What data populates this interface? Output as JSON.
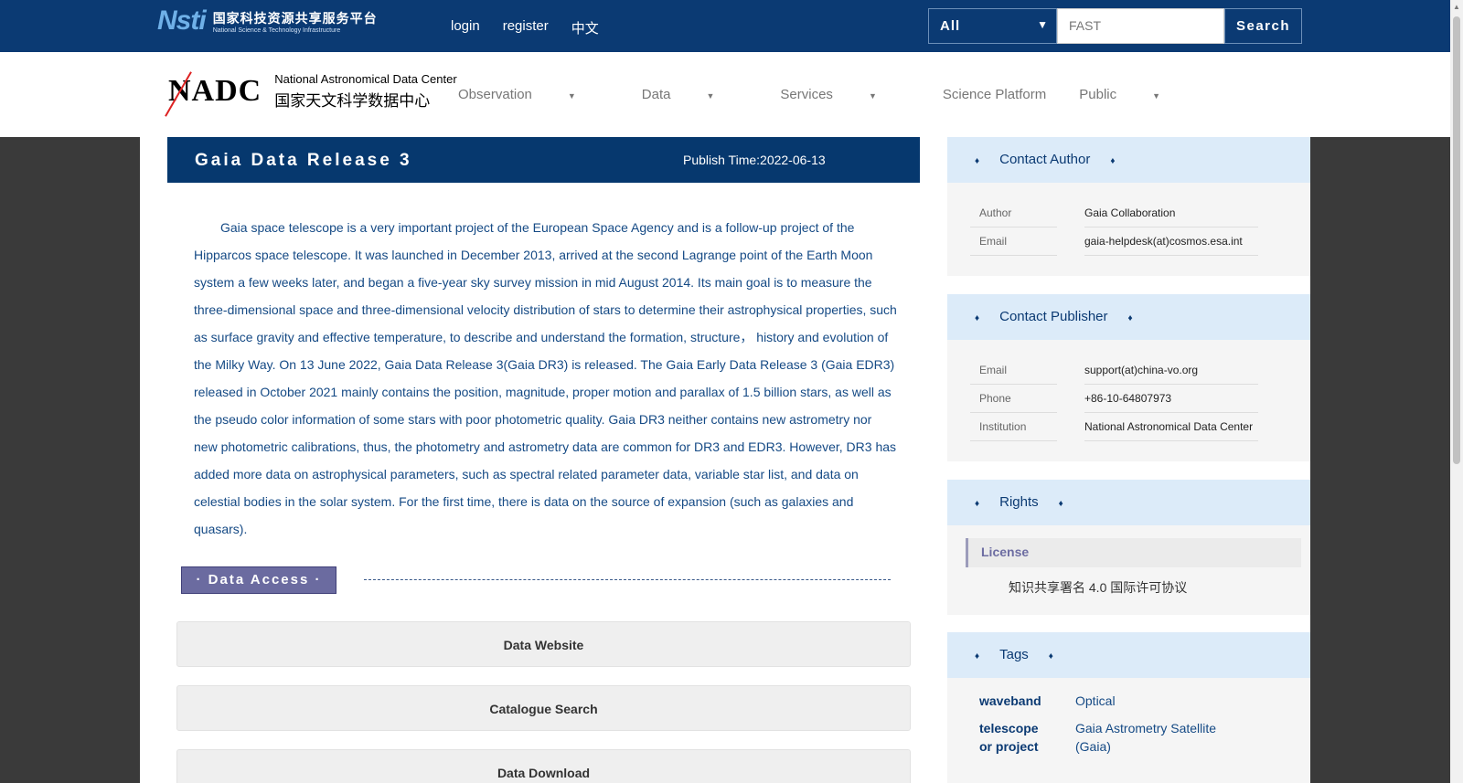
{
  "topbar": {
    "nsti_mark": "Nsti",
    "nsti_cn": "国家科技资源共享服务平台",
    "nsti_en": "National Science & Technology Infrastructure",
    "links": [
      "login",
      "register",
      "中文"
    ],
    "search": {
      "select_value": "All",
      "input_value": "FAST",
      "button_label": "Search"
    }
  },
  "navbar": {
    "nadc_mark": "NADC",
    "nadc_en": "National Astronomical Data Center",
    "nadc_cn": "国家天文科学数据中心",
    "menu": [
      "Observation",
      "Data",
      "Services",
      "Science Platform",
      "Public"
    ]
  },
  "dataset": {
    "title": "Gaia Data Release 3",
    "publish_time": "Publish Time:2022-06-13",
    "description": "Gaia space telescope is a very important project of the European Space Agency and is a follow-up project of the Hipparcos space telescope. It was launched in December 2013, arrived at the second Lagrange point of the Earth Moon system a few weeks later, and began a five-year sky survey mission in mid August 2014. Its main goal is to measure the three-dimensional space and three-dimensional velocity distribution of stars to determine their astrophysical properties, such as surface gravity and effective temperature, to describe and understand the formation, structure， history and evolution of the Milky Way. On 13 June 2022, Gaia Data Release 3(Gaia DR3) is released. The Gaia Early Data Release 3 (Gaia EDR3) released in October 2021 mainly contains the position, magnitude, proper motion and parallax of 1.5 billion stars, as well as the pseudo color information of some stars with poor photometric quality. Gaia DR3 neither contains new astrometry nor new photometric calibrations, thus, the photometry and astrometry data are common for DR3 and EDR3. However, DR3 has added more data on astrophysical parameters, such as spectral related parameter data, variable star list, and data on celestial bodies in the solar system. For the first time, there is data on the source of expansion (such as galaxies and quasars).",
    "data_access_label": "· Data Access ·",
    "access_buttons": [
      "Data Website",
      "Catalogue Search",
      "Data Download"
    ]
  },
  "sidebar": {
    "contact_author": {
      "title": "Contact Author",
      "rows": [
        {
          "key": "Author",
          "value": "Gaia Collaboration"
        },
        {
          "key": "Email",
          "value": "gaia-helpdesk(at)cosmos.esa.int"
        }
      ]
    },
    "contact_publisher": {
      "title": "Contact Publisher",
      "rows": [
        {
          "key": "Email",
          "value": "support(at)china-vo.org"
        },
        {
          "key": "Phone",
          "value": "+86-10-64807973"
        },
        {
          "key": "Institution",
          "value": "National Astronomical Data Center"
        }
      ]
    },
    "rights": {
      "title": "Rights",
      "license_label": "License",
      "license_text": "知识共享署名 4.0 国际许可协议"
    },
    "tags": {
      "title": "Tags",
      "rows": [
        {
          "key": "waveband",
          "value": "Optical"
        },
        {
          "key": "telescope or project",
          "value": "Gaia Astrometry Satellite (Gaia)"
        }
      ]
    },
    "diamond": "♦"
  },
  "colors": {
    "header_blue": "#0b3a73",
    "panel_blue": "#dcebf9",
    "access_purple": "#6b6ba0"
  }
}
